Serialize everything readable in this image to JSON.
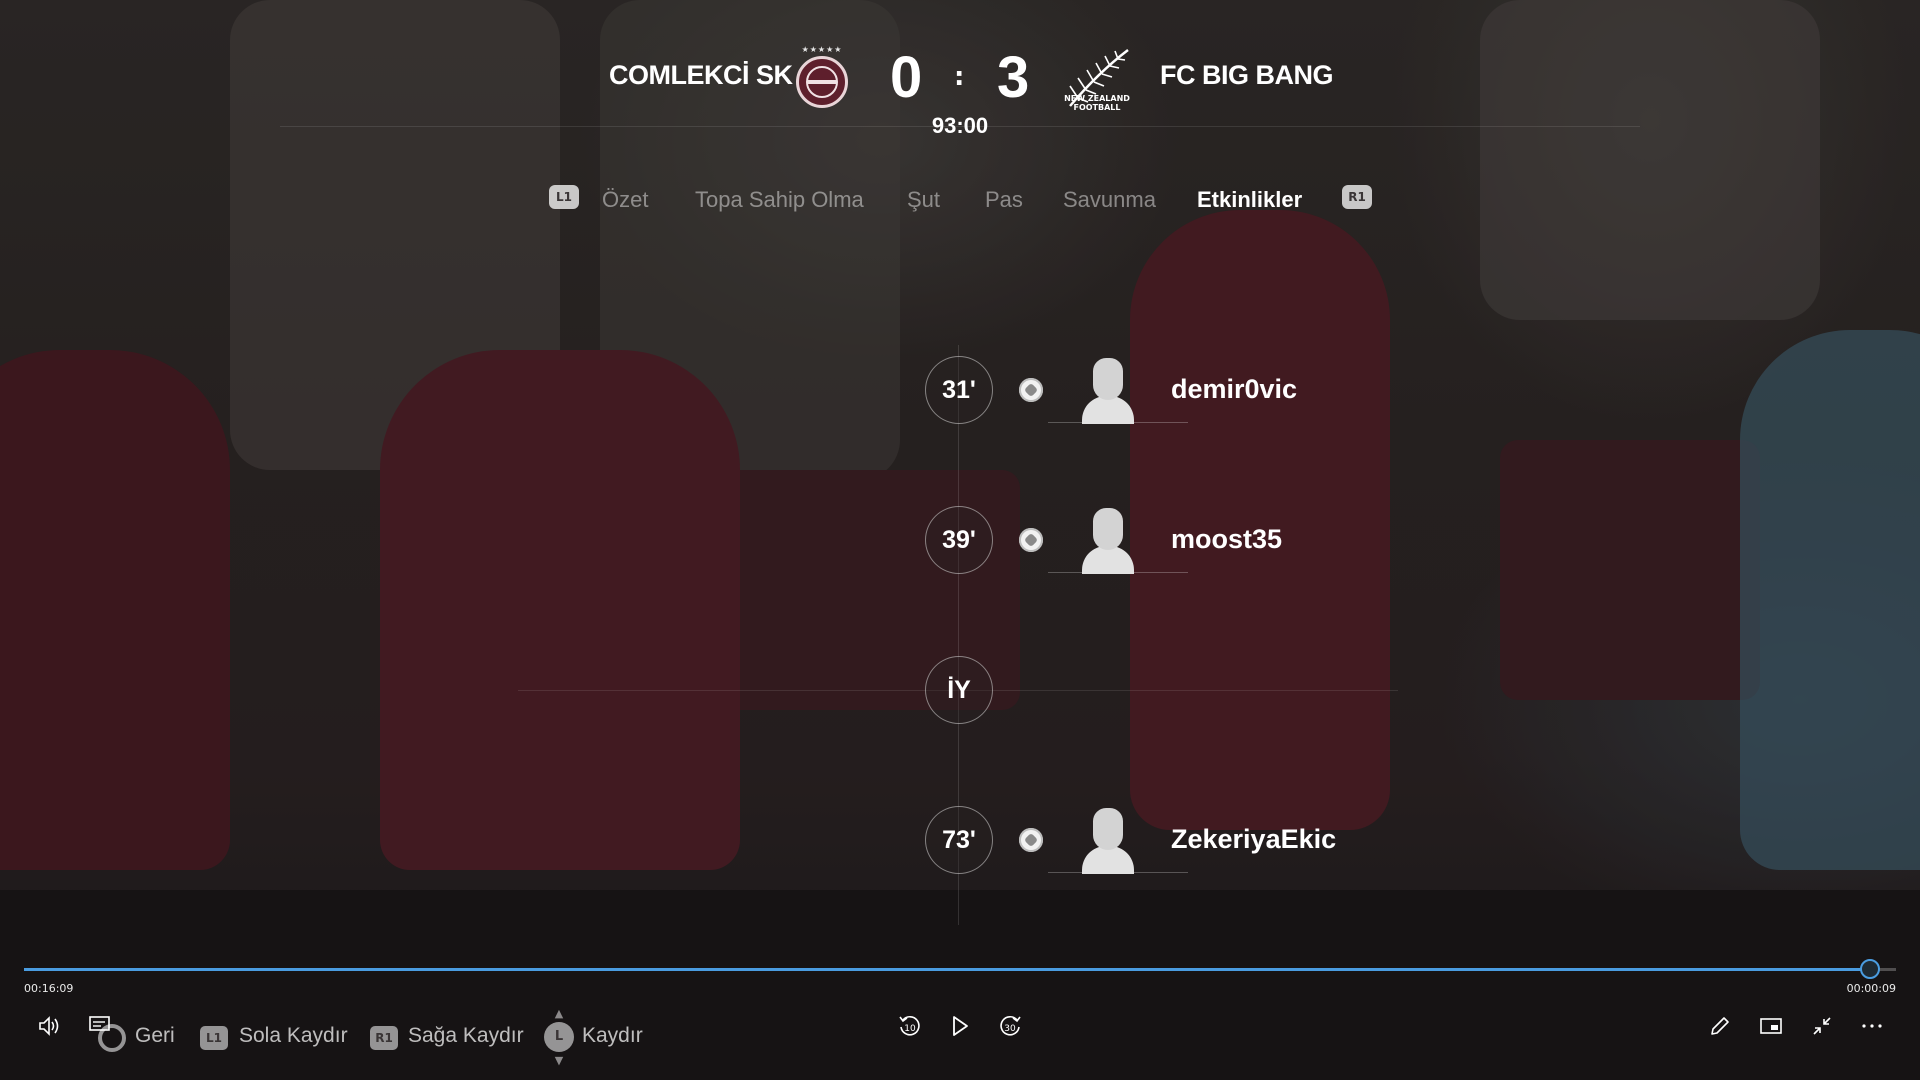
{
  "match": {
    "home_team": "COMLEKCİ SK",
    "away_team": "FC BIG BANG",
    "home_score": "0",
    "separator": ":",
    "away_score": "3",
    "clock": "93:00",
    "away_crest_text": "NEW ZEALAND FOOTBALL"
  },
  "tabs": {
    "left_button": "L1",
    "right_button": "R1",
    "items": [
      "Özet",
      "Topa Sahip Olma",
      "Şut",
      "Pas",
      "Savunma",
      "Etkinlikler"
    ],
    "active": "Etkinlikler"
  },
  "events": [
    {
      "minute": "31'",
      "player": "demir0vic",
      "icon": "goal-ball-icon"
    },
    {
      "minute": "39'",
      "player": "moost35",
      "icon": "goal-ball-icon"
    },
    {
      "minute": "İY"
    },
    {
      "minute": "73'",
      "player": "ZekeriyaEkic",
      "icon": "goal-ball-icon"
    }
  ],
  "player_controls": {
    "elapsed": "00:16:09",
    "remaining": "00:00:09",
    "progress": 0.985,
    "accent_color": "#4a9ce0",
    "skip_back": "10",
    "skip_forward": "30"
  },
  "hints": {
    "back": "Geri",
    "scroll_left_badge": "L1",
    "scroll_left": "Sola Kaydır",
    "scroll_right_badge": "R1",
    "scroll_right": "Sağa Kaydır",
    "scroll_stick": "L",
    "scroll": "Kaydır"
  }
}
